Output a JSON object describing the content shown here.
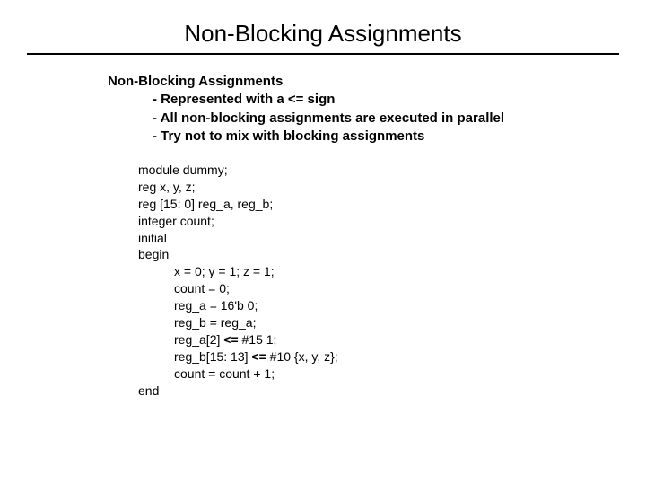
{
  "title": "Non-Blocking Assignments",
  "subhead": "Non-Blocking Assignments",
  "bullets": {
    "b1_pre": "- Represented with a ",
    "b1_bold": "<= sign",
    "b2": "- All non-blocking assignments are executed in parallel",
    "b3": "- Try not to mix with blocking assignments"
  },
  "code": {
    "l1": "module dummy;",
    "l2": "reg x, y, z;",
    "l3": "reg [15: 0] reg_a, reg_b;",
    "l4": "integer count;",
    "l5": "initial",
    "l6": "begin",
    "l7": "x = 0; y = 1; z = 1;",
    "l8": "count = 0;",
    "l9": "reg_a = 16'b 0;",
    "l10": "reg_b = reg_a;",
    "l11a": "reg_a[2] ",
    "l11b": "<=",
    "l11c": " #15 1;",
    "l12a": "reg_b[15: 13] ",
    "l12b": "<=",
    "l12c": " #10 {x, y, z};",
    "l13": "count = count + 1;",
    "l14": "end"
  }
}
